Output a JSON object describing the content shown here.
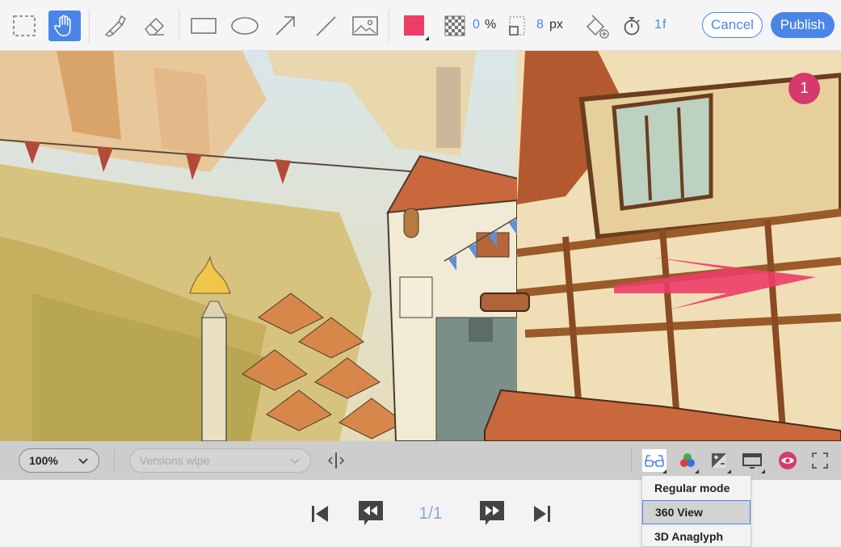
{
  "toolbar": {
    "tools": [
      {
        "name": "select-rect-tool",
        "icon": "dashed-rectangle-icon"
      },
      {
        "name": "hand-tool",
        "icon": "hand-icon",
        "active": true
      },
      {
        "name": "highlighter-tool",
        "icon": "highlighter-icon"
      },
      {
        "name": "eraser-tool",
        "icon": "eraser-icon"
      },
      {
        "name": "rectangle-tool",
        "icon": "rectangle-icon"
      },
      {
        "name": "ellipse-tool",
        "icon": "ellipse-icon"
      },
      {
        "name": "arrow-tool",
        "icon": "arrow-icon"
      },
      {
        "name": "line-tool",
        "icon": "line-icon"
      },
      {
        "name": "image-tool",
        "icon": "image-icon"
      }
    ],
    "color": "#ec3d67",
    "opacity_value": "0",
    "opacity_unit": "%",
    "stroke_value": "8",
    "stroke_unit": "px",
    "frames_value": "1",
    "frames_unit": "f",
    "cancel_label": "Cancel",
    "publish_label": "Publish"
  },
  "canvas": {
    "annotation_badge": "1",
    "accent_color": "#d63a6c"
  },
  "controls": {
    "zoom": "100%",
    "versions_placeholder": "Versions wipe",
    "view_modes": {
      "items": [
        "Regular mode",
        "360 View",
        "3D Anaglyph"
      ],
      "highlighted": "360 View"
    }
  },
  "playback": {
    "frame_counter": "1/1"
  }
}
